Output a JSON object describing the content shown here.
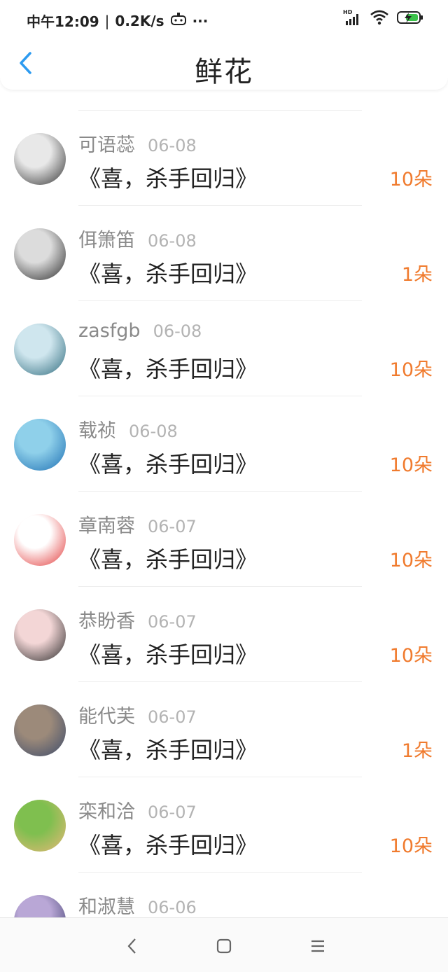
{
  "status_bar": {
    "time": "中午12:09",
    "speed": "0.2K/s",
    "more": "···",
    "signal_label": "HD"
  },
  "header": {
    "title": "鲜花"
  },
  "list": {
    "items": [
      {
        "name": "可语蕊",
        "date": "06-08",
        "work": "《喜，杀手回归》",
        "count": "10朵",
        "avatar_colors": [
          "#333333",
          "#e8e8e8"
        ]
      },
      {
        "name": "佴箫笛",
        "date": "06-08",
        "work": "《喜，杀手回归》",
        "count": "1朵",
        "avatar_colors": [
          "#2b2b2b",
          "#dcdcdc"
        ]
      },
      {
        "name": "zasfgb",
        "date": "06-08",
        "work": "《喜，杀手回归》",
        "count": "10朵",
        "avatar_colors": [
          "#2e6b7d",
          "#cfe6ee"
        ]
      },
      {
        "name": "载祯",
        "date": "06-08",
        "work": "《喜，杀手回归》",
        "count": "10朵",
        "avatar_colors": [
          "#1d6fb3",
          "#8fd0ea"
        ]
      },
      {
        "name": "章南蓉",
        "date": "06-07",
        "work": "《喜，杀手回归》",
        "count": "10朵",
        "avatar_colors": [
          "#e23a3a",
          "#ffffff"
        ]
      },
      {
        "name": "恭盼香",
        "date": "06-07",
        "work": "《喜，杀手回归》",
        "count": "10朵",
        "avatar_colors": [
          "#2a2a2a",
          "#f3d6d6"
        ]
      },
      {
        "name": "能代芙",
        "date": "06-07",
        "work": "《喜，杀手回归》",
        "count": "1朵",
        "avatar_colors": [
          "#3b4a6a",
          "#9c8a7a"
        ]
      },
      {
        "name": "栾和洽",
        "date": "06-07",
        "work": "《喜，杀手回归》",
        "count": "10朵",
        "avatar_colors": [
          "#e8b878",
          "#7fbf4f"
        ]
      },
      {
        "name": "和淑慧",
        "date": "06-06",
        "work": "",
        "count": "",
        "avatar_colors": [
          "#3a3a6a",
          "#b9a7d6"
        ]
      }
    ]
  },
  "colors": {
    "accent": "#2d9bf0",
    "count": "#f07b2e"
  }
}
